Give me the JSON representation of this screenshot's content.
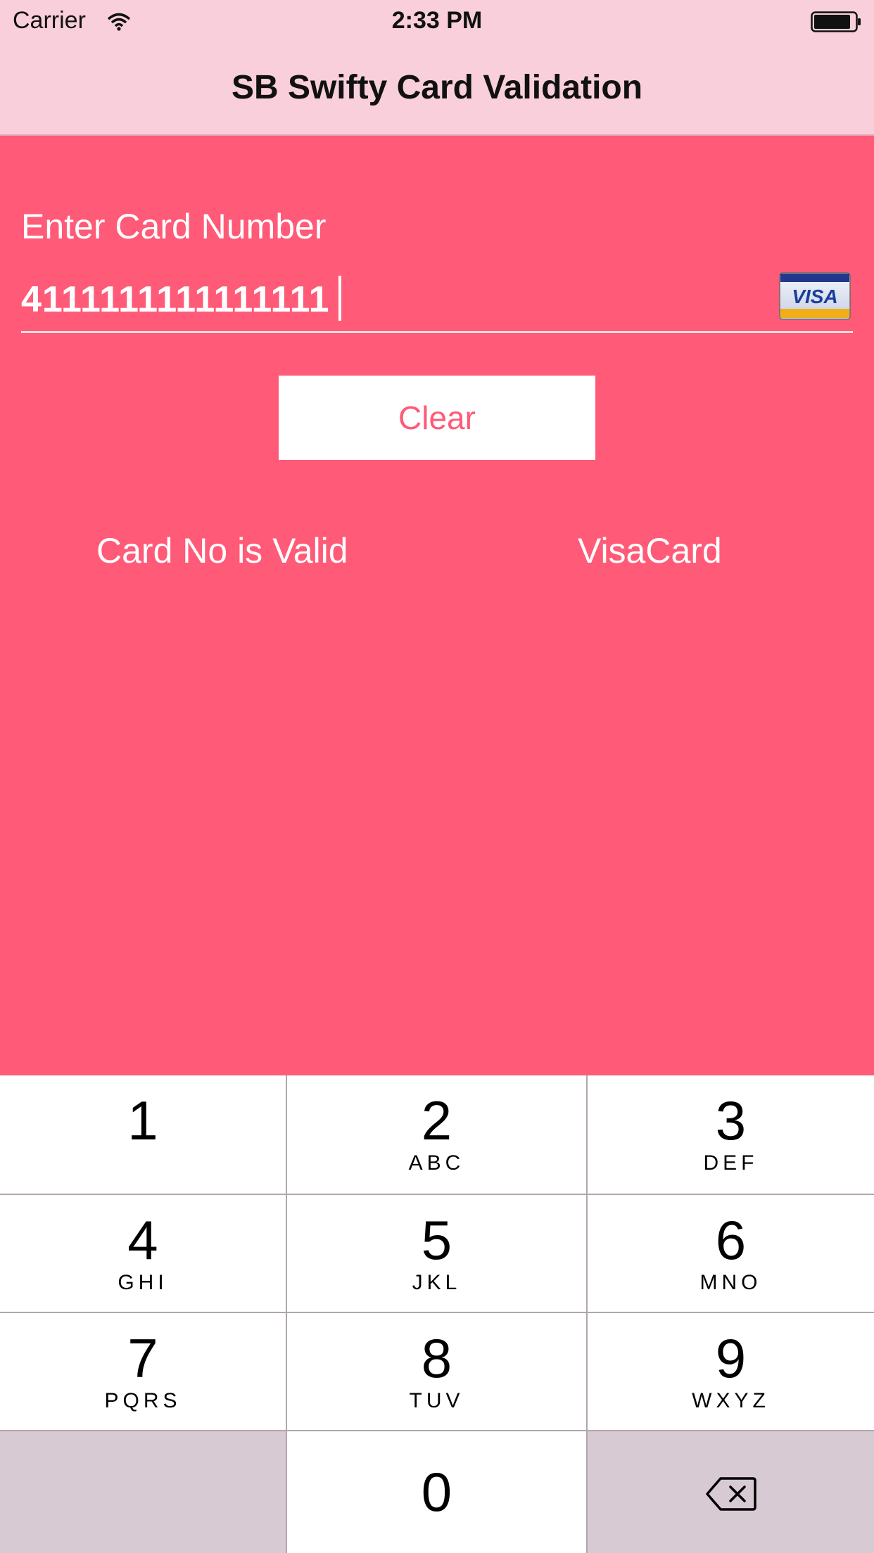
{
  "status_bar": {
    "carrier": "Carrier",
    "time": "2:33 PM"
  },
  "nav": {
    "title": "SB Swifty Card Validation"
  },
  "form": {
    "label": "Enter Card Number",
    "card_number": "4111111111111111",
    "card_brand_icon": "visa-card-icon",
    "clear_label": "Clear"
  },
  "result": {
    "status": "Card No is Valid",
    "card_type": "VisaCard"
  },
  "keypad": {
    "keys": [
      {
        "digit": "1",
        "letters": ""
      },
      {
        "digit": "2",
        "letters": "ABC"
      },
      {
        "digit": "3",
        "letters": "DEF"
      },
      {
        "digit": "4",
        "letters": "GHI"
      },
      {
        "digit": "5",
        "letters": "JKL"
      },
      {
        "digit": "6",
        "letters": "MNO"
      },
      {
        "digit": "7",
        "letters": "PQRS"
      },
      {
        "digit": "8",
        "letters": "TUV"
      },
      {
        "digit": "9",
        "letters": "WXYZ"
      },
      {
        "digit": "0",
        "letters": ""
      }
    ],
    "delete_icon": "backspace-icon"
  },
  "colors": {
    "background": "#ff5a77",
    "nav_background": "#f8cfda",
    "key_light": "#ffffff",
    "key_dark": "#d8cad2"
  }
}
